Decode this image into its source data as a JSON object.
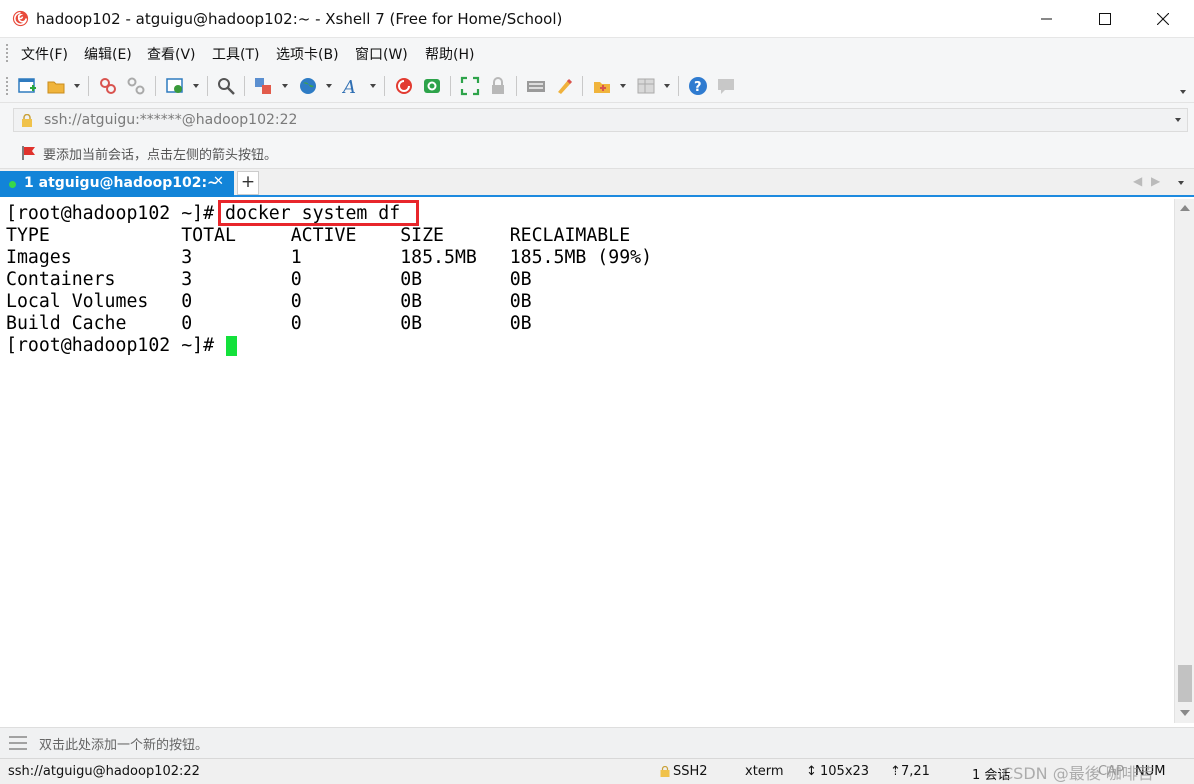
{
  "window": {
    "title": "hadoop102 - atguigu@hadoop102:~ - Xshell 7 (Free for Home/School)"
  },
  "menu": [
    "文件(F)",
    "编辑(E)",
    "查看(V)",
    "工具(T)",
    "选项卡(B)",
    "窗口(W)",
    "帮助(H)"
  ],
  "toolbar_icons": [
    "new-session-icon",
    "open-folder-icon",
    "connect-icon",
    "disconnect-icon",
    "properties-icon",
    "find-icon",
    "transfer-icon",
    "globe-icon",
    "font-icon",
    "xftp-icon",
    "xshell-plus-icon",
    "fullscreen-icon",
    "lock-icon",
    "keyboard-icon",
    "highlight-icon",
    "script-icon",
    "layout-icon",
    "help-icon",
    "chat-icon"
  ],
  "address": {
    "value": "ssh://atguigu:******@hadoop102:22"
  },
  "hint": {
    "text": "要添加当前会话，点击左侧的箭头按钮。"
  },
  "tabs": [
    {
      "label": "1 atguigu@hadoop102:~"
    }
  ],
  "terminal": {
    "lines": [
      "[root@hadoop102 ~]# docker system df",
      "TYPE            TOTAL     ACTIVE    SIZE      RECLAIMABLE",
      "Images          3         1         185.5MB   185.5MB (99%)",
      "Containers      3         0         0B        0B",
      "Local Volumes   0         0         0B        0B",
      "Build Cache     0         0         0B        0B",
      "[root@hadoop102 ~]# "
    ],
    "highlighted_command": "docker system df",
    "highlight_color": "#e8262b",
    "cursor_color": "#13e13b"
  },
  "quickbar": {
    "text": "双击此处添加一个新的按钮。"
  },
  "status": {
    "connection": "ssh://atguigu@hadoop102:22",
    "protocol": "SSH2",
    "terminal_type": "xterm",
    "size": "105x23",
    "cursor_pos": "7,21",
    "sessions": "1 会话",
    "caps": "CAP",
    "num": "NUM"
  },
  "watermark": "CSDN @最後 咖啡苦",
  "colors": {
    "accent": "#1284d8",
    "tab_active": "#1284d8"
  }
}
